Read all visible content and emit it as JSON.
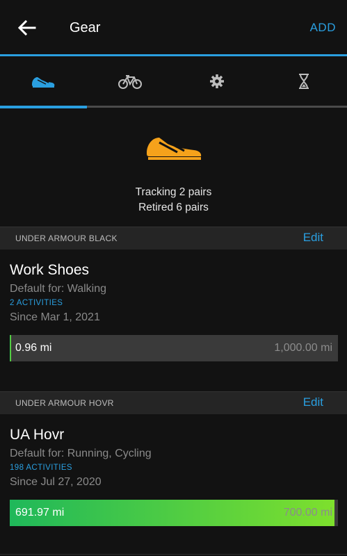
{
  "header": {
    "title": "Gear",
    "add_label": "ADD"
  },
  "tabs": [
    {
      "icon": "shoe-icon",
      "active": true
    },
    {
      "icon": "bicycle-icon",
      "active": false
    },
    {
      "icon": "gear-icon",
      "active": false
    },
    {
      "icon": "hourglass-icon",
      "active": false
    }
  ],
  "summary": {
    "tracking": "Tracking 2 pairs",
    "retired": "Retired 6 pairs"
  },
  "colors": {
    "accent": "#2a9fe0",
    "shoe": "#f5a21b",
    "progress_start": "#1fb85a",
    "progress_end": "#7ee02d"
  },
  "gear": [
    {
      "brand": "UNDER ARMOUR BLACK",
      "edit_label": "Edit",
      "name": "Work Shoes",
      "default_for": "Default for: Walking",
      "activities": "2 ACTIVITIES",
      "since": "Since Mar 1, 2021",
      "current": "0.96 mi",
      "goal": "1,000.00 mi",
      "progress_fraction": 0.00096
    },
    {
      "brand": "UNDER ARMOUR HOVR",
      "edit_label": "Edit",
      "name": "UA Hovr",
      "default_for": "Default for: Running, Cycling",
      "activities": "198 ACTIVITIES",
      "since": "Since Jul 27, 2020",
      "current": "691.97 mi",
      "goal": "700.00 mi",
      "progress_fraction": 0.9885
    }
  ]
}
